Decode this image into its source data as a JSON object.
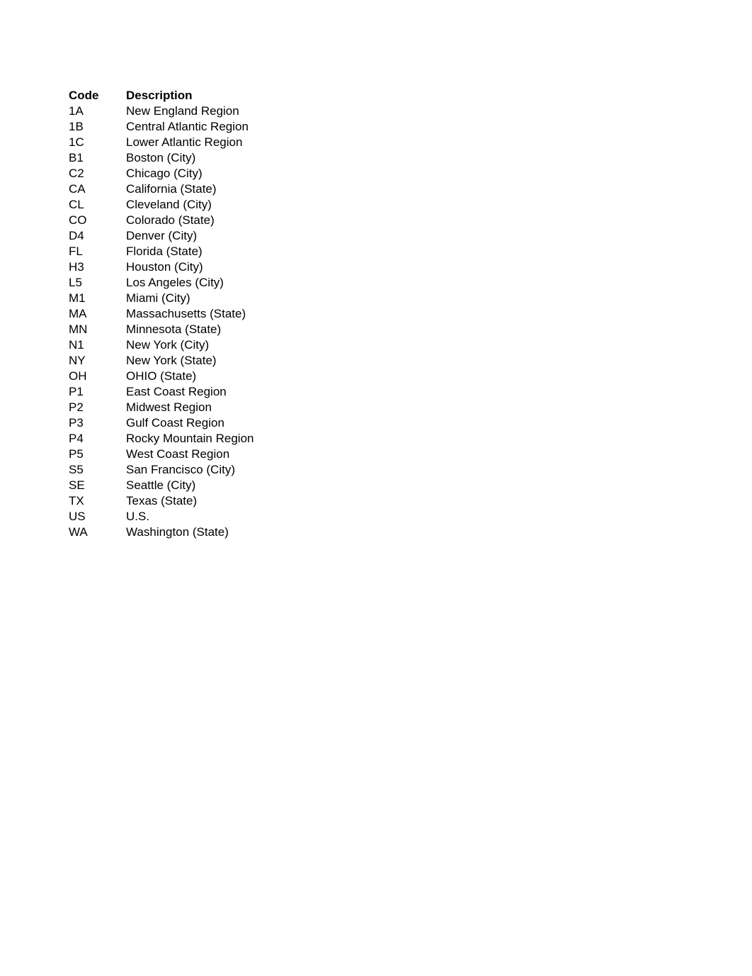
{
  "document": {
    "background_color": "#ffffff",
    "text_color": "#000000"
  },
  "table": {
    "headers": {
      "code": "Code",
      "description": "Description"
    },
    "rows": [
      {
        "code": "1A",
        "description": "New England Region"
      },
      {
        "code": "1B",
        "description": "Central Atlantic Region"
      },
      {
        "code": "1C",
        "description": "Lower Atlantic Region"
      },
      {
        "code": "B1",
        "description": "Boston (City)"
      },
      {
        "code": "C2",
        "description": "Chicago (City)"
      },
      {
        "code": "CA",
        "description": "California (State)"
      },
      {
        "code": "CL",
        "description": "Cleveland (City)"
      },
      {
        "code": "CO",
        "description": "Colorado (State)"
      },
      {
        "code": "D4",
        "description": "Denver (City)"
      },
      {
        "code": "FL",
        "description": "Florida (State)"
      },
      {
        "code": "H3",
        "description": "Houston (City)"
      },
      {
        "code": "L5",
        "description": "Los Angeles (City)"
      },
      {
        "code": "M1",
        "description": "Miami (City)"
      },
      {
        "code": "MA",
        "description": "Massachusetts (State)"
      },
      {
        "code": "MN",
        "description": "Minnesota (State)"
      },
      {
        "code": "N1",
        "description": "New York (City)"
      },
      {
        "code": "NY",
        "description": "New York (State)"
      },
      {
        "code": "OH",
        "description": "OHIO (State)"
      },
      {
        "code": "P1",
        "description": "East Coast Region"
      },
      {
        "code": "P2",
        "description": "Midwest Region"
      },
      {
        "code": "P3",
        "description": "Gulf Coast Region"
      },
      {
        "code": "P4",
        "description": "Rocky Mountain Region"
      },
      {
        "code": "P5",
        "description": "West Coast Region"
      },
      {
        "code": "S5",
        "description": "San Francisco (City)"
      },
      {
        "code": "SE",
        "description": "Seattle (City)"
      },
      {
        "code": "TX",
        "description": "Texas (State)"
      },
      {
        "code": "US",
        "description": "U.S."
      },
      {
        "code": "WA",
        "description": "Washington (State)"
      }
    ]
  }
}
